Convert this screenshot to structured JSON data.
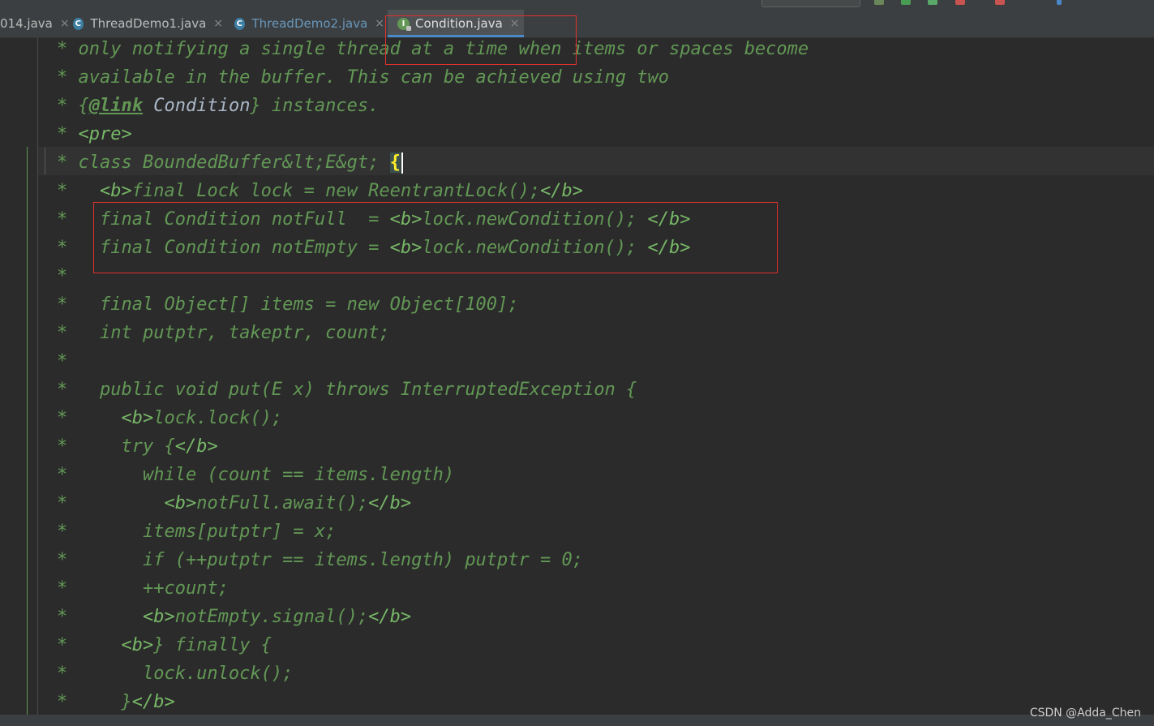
{
  "colors": {
    "background": "#2b2b2b",
    "doc_comment": "#629755",
    "highlight_box": "#e0312e",
    "active_tab_underline": "#4a88c7"
  },
  "tabs": [
    {
      "label": "014.java",
      "icon": "none",
      "close": "×"
    },
    {
      "label": "ThreadDemo1.java",
      "icon": "class-icon",
      "icon_letter": "C",
      "close": "×"
    },
    {
      "label": "ThreadDemo2.java",
      "icon": "class-icon",
      "icon_letter": "C",
      "close": "×"
    },
    {
      "label": "Condition.java",
      "icon": "interface-icon",
      "icon_letter": "I",
      "close": "×",
      "active": true
    }
  ],
  "code": {
    "line_01": "* only notifying a single thread at a time when items or spaces become",
    "line_02": "* available in the buffer. This can be achieved using two",
    "line_03": {
      "pre": "* {",
      "tag": "@link",
      "ref": " Condition",
      "post": "} instances."
    },
    "line_04": "* <pre>",
    "line_05": {
      "text": "* class BoundedBuffer&lt;E&gt; ",
      "brace": "{"
    },
    "line_06": "*   <b>final Lock lock = new ReentrantLock();</b>",
    "line_07": "*   final Condition notFull  = <b>lock.newCondition(); </b>",
    "line_08": "*   final Condition notEmpty = <b>lock.newCondition(); </b>",
    "line_09": "*",
    "line_10": "*   final Object[] items = new Object[100];",
    "line_11": "*   int putptr, takeptr, count;",
    "line_12": "*",
    "line_13": "*   public void put(E x) throws InterruptedException {",
    "line_14": "*     <b>lock.lock();",
    "line_15": "*     try {</b>",
    "line_16": "*       while (count == items.length)",
    "line_17": "*         <b>notFull.await();</b>",
    "line_18": "*       items[putptr] = x;",
    "line_19": "*       if (++putptr == items.length) putptr = 0;",
    "line_20": "*       ++count;",
    "line_21": "*       <b>notEmpty.signal();</b>",
    "line_22": "*     <b>} finally {",
    "line_23": "*       lock.unlock();",
    "line_24": "*     }</b>"
  },
  "watermark": "CSDN @Adda_Chen"
}
